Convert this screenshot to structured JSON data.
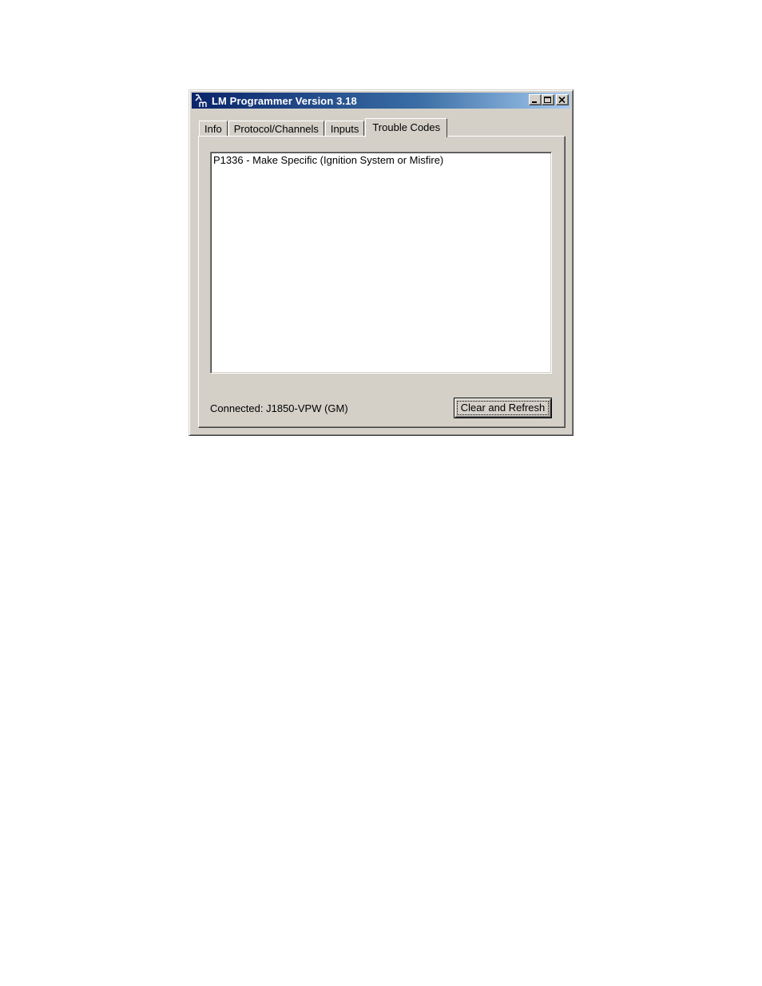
{
  "window": {
    "title": "LM Programmer Version 3.18",
    "icon": "lambda-app-icon"
  },
  "titlebar_buttons": {
    "minimize": "minimize-icon",
    "maximize": "maximize-icon",
    "close": "close-icon"
  },
  "tabs": [
    {
      "label": "Info",
      "active": false
    },
    {
      "label": "Protocol/Channels",
      "active": false
    },
    {
      "label": "Inputs",
      "active": false
    },
    {
      "label": "Trouble Codes",
      "active": true
    }
  ],
  "trouble_codes": {
    "items": [
      "P1336 - Make Specific (Ignition System or Misfire)"
    ]
  },
  "footer": {
    "status": "Connected: J1850-VPW (GM)",
    "clear_refresh_label": "Clear and Refresh"
  },
  "colors": {
    "title_gradient_start": "#0a246a",
    "title_gradient_end": "#a6caf0",
    "face": "#d4d0c8"
  }
}
